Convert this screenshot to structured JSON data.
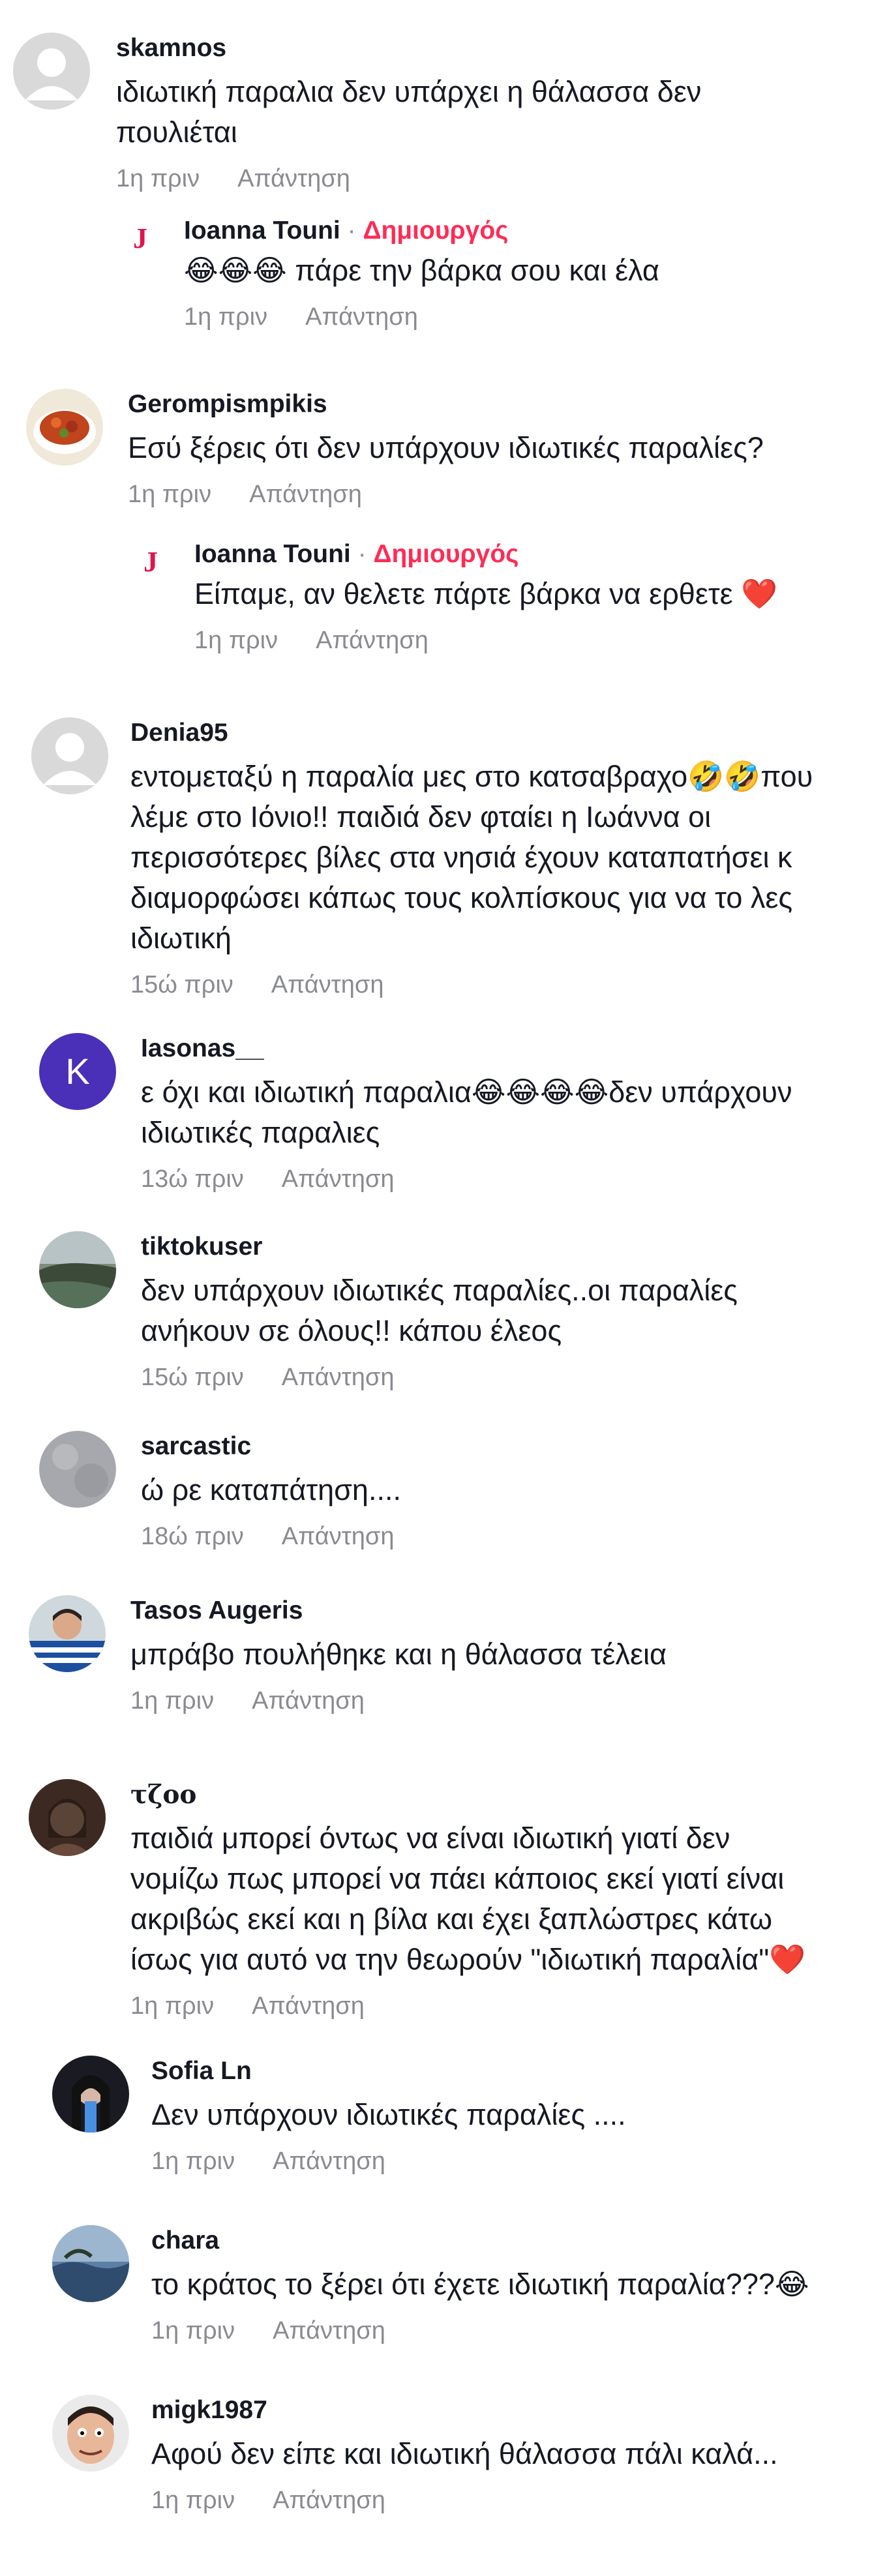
{
  "reply_label": "Απάντηση",
  "comments": [
    {
      "user": "skamnos",
      "lines": [
        "ιδιωτική παραλια δεν υπάρχει η θάλασσα δεν",
        "πουλιέται"
      ],
      "time": "1η πριν"
    },
    {
      "user": "Ioanna Touni",
      "badge": "Δημιουργός",
      "dot": "·",
      "text": "😂😂😂 πάρε την βάρκα σου και έλα",
      "time": "1η πριν",
      "reply": true
    },
    {
      "user": "Gerompismpikis",
      "lines": [
        "Εσύ ξέρεις ότι δεν υπάρχουν ιδιωτικές παραλίες?"
      ],
      "time": "1η πριν"
    },
    {
      "user": "Ioanna Touni",
      "badge": "Δημιουργός",
      "dot": "·",
      "text": "Είπαμε, αν θελετε πάρτε βάρκα να ερθετε ❤️",
      "time": "1η πριν",
      "reply": true
    },
    {
      "user": "Denia95",
      "lines": [
        "εντομεταξύ η παραλία μες στο κατσαβραχο🤣🤣που",
        "λέμε στο Ιόνιο!! παιδιά δεν φταίει η Ιωάννα οι",
        "περισσότερες βίλες στα νησιά έχουν καταπατήσει κ",
        "διαμορφώσει κάπως τους κολπίσκους για να το λες",
        "ιδιωτική"
      ],
      "time": "15ώ πριν"
    },
    {
      "user": "Iasonas__",
      "avatar_letter": "K",
      "lines": [
        "ε όχι και ιδιωτική παραλια😂😂😂😂δεν υπάρχουν",
        "ιδιωτικές παραλιες"
      ],
      "time": "13ώ πριν"
    },
    {
      "user": "tiktokuser",
      "lines": [
        "δεν υπάρχουν ιδιωτικές παραλίες..οι παραλίες",
        "ανήκουν σε όλους!! κάπου έλεος"
      ],
      "time": "15ώ πριν"
    },
    {
      "user": "sarcastic",
      "lines": [
        "ώ ρε καταπάτηση...."
      ],
      "time": "18ώ πριν"
    },
    {
      "user": "Tasos Augeris",
      "lines": [
        "μπράβο πουλήθηκε και η θάλασσα τέλεια"
      ],
      "time": "1η πριν"
    },
    {
      "user": "τζoo",
      "lines": [
        "παιδιά μπορεί όντως να είναι ιδιωτική γιατί δεν",
        "νομίζω πως μπορεί να πάει κάποιος εκεί γιατί είναι",
        "ακριβώς εκεί και η βίλα και έχει ξαπλώστρες κάτω",
        "ίσως για αυτό να την θεωρούν \"ιδιωτική παραλία\"❤️"
      ],
      "time": "1η πριν"
    },
    {
      "user": "Sofia Ln",
      "lines": [
        "Δεν υπάρχουν ιδιωτικές παραλίες ...."
      ],
      "time": "1η πριν"
    },
    {
      "user": "chara",
      "lines": [
        "το κράτος το ξέρει ότι έχετε ιδιωτική παραλία???😂"
      ],
      "time": "1η πριν"
    },
    {
      "user": "migk1987",
      "lines": [
        "Αφού δεν είπε και ιδιωτική θάλασσα πάλι καλά..."
      ],
      "time": "1η πριν"
    }
  ],
  "colors": {
    "creator": "#fe2c55",
    "meta": "#8a8b91",
    "text": "#161823"
  }
}
